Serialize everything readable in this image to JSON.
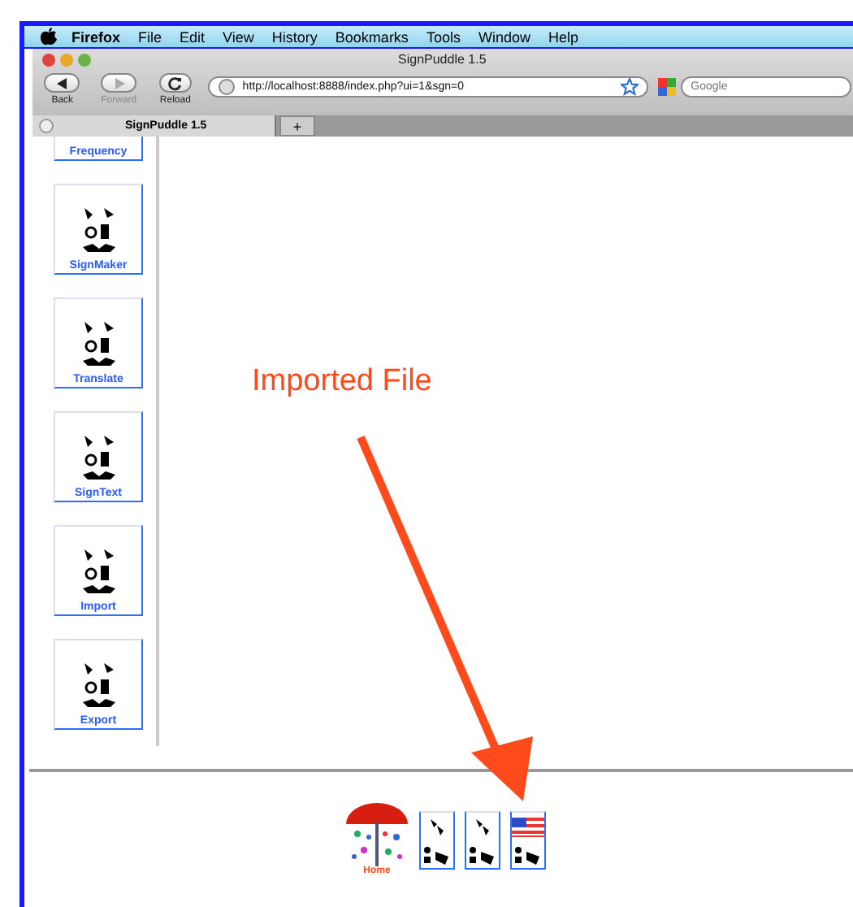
{
  "menu_bar": {
    "app": "Firefox",
    "items": [
      "File",
      "Edit",
      "View",
      "History",
      "Bookmarks",
      "Tools",
      "Window",
      "Help"
    ]
  },
  "window": {
    "title": "SignPuddle 1.5"
  },
  "toolbar": {
    "buttons": [
      {
        "label": "Back",
        "disabled": false
      },
      {
        "label": "Forward",
        "disabled": true
      },
      {
        "label": "Reload",
        "disabled": false
      }
    ],
    "url": "http://localhost:8888/index.php?ui=1&sgn=0",
    "search": {
      "placeholder": "Google"
    }
  },
  "tabs": [
    {
      "label": "SignPuddle 1.5",
      "selected": true
    }
  ],
  "new_tab": "+",
  "sidebar": {
    "items": [
      {
        "label": "Frequency",
        "kind": "cut"
      },
      {
        "label": "SignMaker",
        "kind": "full"
      },
      {
        "label": "Translate",
        "kind": "full"
      },
      {
        "label": "SignText",
        "kind": "full"
      },
      {
        "label": "Import",
        "kind": "full"
      },
      {
        "label": "Export",
        "kind": "full"
      }
    ]
  },
  "annotation": {
    "text": "Imported File"
  },
  "footer": {
    "home": "Home",
    "tiles": [
      {
        "flag": false
      },
      {
        "flag": false
      },
      {
        "flag": true
      }
    ]
  }
}
